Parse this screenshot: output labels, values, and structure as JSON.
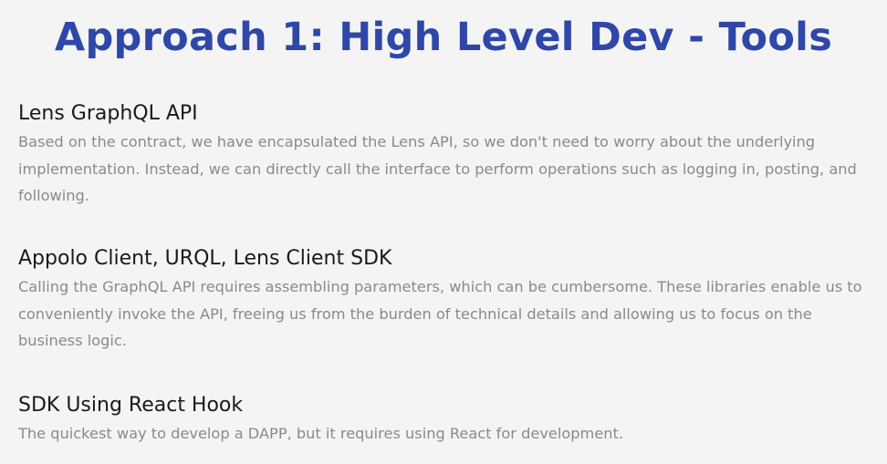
{
  "slide": {
    "title": "Approach 1: High Level Dev - Tools",
    "title_color": "#2f47a8",
    "sections": [
      {
        "heading": "Lens GraphQL API",
        "body": "Based on the contract, we have encapsulated the Lens API, so we don't need to worry about the underlying implementation. Instead, we can directly call the interface to perform operations such as logging in, posting, and following."
      },
      {
        "heading": "Appolo Client, URQL, Lens Client SDK",
        "body": "Calling the GraphQL API requires assembling parameters, which can be cumbersome. These libraries enable us to conveniently invoke the API, freeing us from the burden of technical details and allowing us to focus on the business logic."
      },
      {
        "heading": "SDK Using React Hook",
        "body": "The quickest way to develop a DAPP, but it requires using React for development."
      }
    ]
  }
}
